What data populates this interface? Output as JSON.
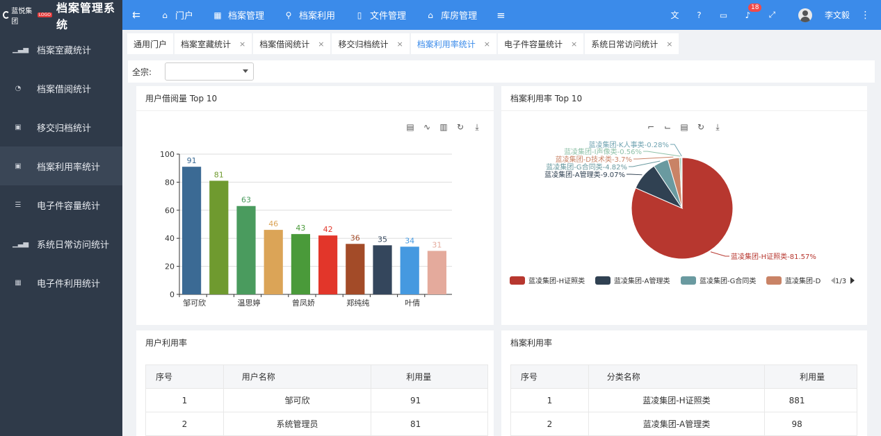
{
  "header": {
    "brand_logo_text": "蓝悦集团",
    "brand_logo_tag": "LOGO",
    "app_title": "档案管理系统",
    "nav": [
      {
        "label": "门户",
        "icon": "home-icon"
      },
      {
        "label": "档案管理",
        "icon": "archive-icon"
      },
      {
        "label": "档案利用",
        "icon": "search-icon"
      },
      {
        "label": "文件管理",
        "icon": "file-icon"
      },
      {
        "label": "库房管理",
        "icon": "warehouse-icon"
      }
    ],
    "notification_count": "18",
    "username": "李文毅"
  },
  "sidebar": {
    "items": [
      {
        "label": "档案室藏统计",
        "icon": "bar-chart-icon",
        "active": false
      },
      {
        "label": "档案借阅统计",
        "icon": "pie-chart-icon",
        "active": false
      },
      {
        "label": "移交归档统计",
        "icon": "area-chart-icon",
        "active": false
      },
      {
        "label": "档案利用率统计",
        "icon": "image-chart-icon",
        "active": true
      },
      {
        "label": "电子件容量统计",
        "icon": "database-icon",
        "active": false
      },
      {
        "label": "系统日常访问统计",
        "icon": "line-chart-icon",
        "active": false
      },
      {
        "label": "电子件利用统计",
        "icon": "table-icon",
        "active": false
      }
    ]
  },
  "tabs": [
    {
      "label": "通用门户",
      "closable": false,
      "active": false
    },
    {
      "label": "档案室藏统计",
      "closable": true,
      "active": false
    },
    {
      "label": "档案借阅统计",
      "closable": true,
      "active": false
    },
    {
      "label": "移交归档统计",
      "closable": true,
      "active": false
    },
    {
      "label": "档案利用率统计",
      "closable": true,
      "active": true
    },
    {
      "label": "电子件容量统计",
      "closable": true,
      "active": false
    },
    {
      "label": "系统日常访问统计",
      "closable": true,
      "active": false
    }
  ],
  "filter": {
    "label": "全宗:",
    "value": ""
  },
  "panels": {
    "bar_title": "用户借阅量 Top 10",
    "pie_title": "档案利用率 Top 10",
    "user_table_title": "用户利用率",
    "archive_table_title": "档案利用率"
  },
  "chart_data": [
    {
      "type": "bar",
      "title": "",
      "categories": [
        "邹可欣",
        "",
        "温思婷",
        "",
        "曾凤娇",
        "",
        "郑纯纯",
        "",
        "叶倩",
        ""
      ],
      "values": [
        91,
        81,
        63,
        46,
        43,
        42,
        36,
        35,
        34,
        31
      ],
      "colors": [
        "#3b6a94",
        "#6f9a2f",
        "#4a9b5e",
        "#dba457",
        "#4a9a3a",
        "#e2362a",
        "#a34b28",
        "#34465c",
        "#4599e0",
        "#e4aa9c"
      ],
      "ylim": [
        0,
        100
      ],
      "yticks": [
        0,
        20,
        40,
        60,
        80,
        100
      ],
      "grid": true
    },
    {
      "type": "pie",
      "slices": [
        {
          "label": "蓝凌集团-H证照类-81.57%",
          "name": "蓝凌集团-H证照类",
          "value": 81.57,
          "color": "#b7372f"
        },
        {
          "label": "蓝凌集团-A管理类-9.07%",
          "name": "蓝凌集团-A管理类",
          "value": 9.07,
          "color": "#304152"
        },
        {
          "label": "蓝凌集团-G合同类-4.82%",
          "name": "蓝凌集团-G合同类",
          "value": 4.82,
          "color": "#6a9aa0"
        },
        {
          "label": "蓝凌集团-D技术类-3.7%",
          "name": "蓝凌集团-D技术类",
          "value": 3.7,
          "color": "#c98366"
        },
        {
          "label": "蓝凌集团-I声像类-0.56%",
          "name": "蓝凌集团-I声像类",
          "value": 0.56,
          "color": "#8fc1a8"
        },
        {
          "label": "蓝凌集团-K人事类-0.28%",
          "name": "蓝凌集团-K人事类",
          "value": 0.28,
          "color": "#6fa3b1"
        }
      ],
      "legend_visible": [
        "蓝凌集团-H证照类",
        "蓝凌集团-A管理类",
        "蓝凌集团-G合同类",
        "蓝凌集团-D"
      ],
      "legend_page": "1/3",
      "legend_placement": "bottom"
    }
  ],
  "user_table": {
    "columns": [
      "序号",
      "用户名称",
      "利用量"
    ],
    "rows": [
      [
        "1",
        "邹可欣",
        "91"
      ],
      [
        "2",
        "系统管理员",
        "81"
      ]
    ]
  },
  "archive_table": {
    "columns": [
      "序号",
      "分类名称",
      "利用量"
    ],
    "rows": [
      [
        "1",
        "蓝凌集团-H证照类",
        "881"
      ],
      [
        "2",
        "蓝凌集团-A管理类",
        "98"
      ]
    ]
  }
}
